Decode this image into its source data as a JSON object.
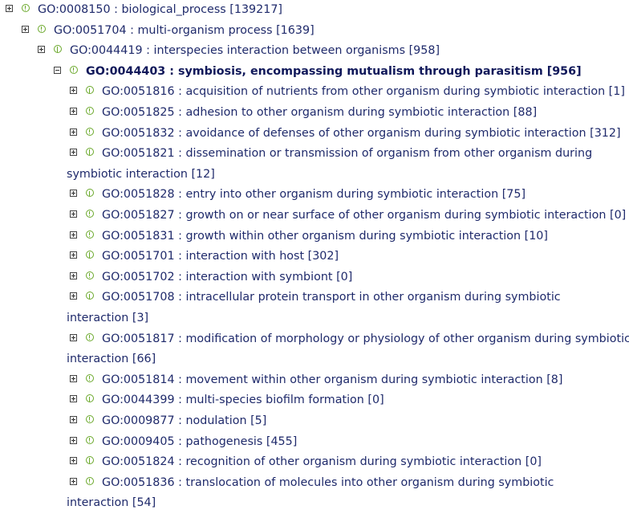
{
  "tree": [
    {
      "id": "GO:0008150",
      "name": "biological_process",
      "count": "[139217]",
      "expanded": false,
      "level": 0
    },
    {
      "id": "GO:0051704",
      "name": "multi-organism process",
      "count": "[1639]",
      "expanded": false,
      "level": 1
    },
    {
      "id": "GO:0044419",
      "name": "interspecies interaction between organisms",
      "count": "[958]",
      "expanded": false,
      "level": 2
    },
    {
      "id": "GO:0044403",
      "name": "symbiosis, encompassing mutualism through parasitism",
      "count": "[956]",
      "expanded": true,
      "level": 3,
      "bold": true
    },
    {
      "id": "GO:0051816",
      "name": "acquisition of nutrients from other organism during symbiotic interaction",
      "count": "[1]",
      "level": 4
    },
    {
      "id": "GO:0051825",
      "name": "adhesion to other organism during symbiotic interaction",
      "count": "[88]",
      "level": 4
    },
    {
      "id": "GO:0051832",
      "name": "avoidance of defenses of other organism during symbiotic interaction",
      "count": "[312]",
      "level": 4
    },
    {
      "id": "GO:0051821",
      "name": "dissemination or transmission of organism from other organism during",
      "cont": "symbiotic interaction",
      "count": "[12]",
      "level": 4
    },
    {
      "id": "GO:0051828",
      "name": "entry into other organism during symbiotic interaction",
      "count": "[75]",
      "level": 4
    },
    {
      "id": "GO:0051827",
      "name": "growth on or near surface of other organism during symbiotic interaction",
      "count": "[0]",
      "level": 4
    },
    {
      "id": "GO:0051831",
      "name": "growth within other organism during symbiotic interaction",
      "count": "[10]",
      "level": 4
    },
    {
      "id": "GO:0051701",
      "name": "interaction with host",
      "count": "[302]",
      "level": 4
    },
    {
      "id": "GO:0051702",
      "name": "interaction with symbiont",
      "count": "[0]",
      "level": 4
    },
    {
      "id": "GO:0051708",
      "name": "intracellular protein transport in other organism during symbiotic",
      "cont": "interaction",
      "count": "[3]",
      "level": 4
    },
    {
      "id": "GO:0051817",
      "name": "modification of morphology or physiology of other organism during symbiotic",
      "cont": "interaction",
      "count": "[66]",
      "level": 4
    },
    {
      "id": "GO:0051814",
      "name": "movement within other organism during symbiotic interaction",
      "count": "[8]",
      "level": 4
    },
    {
      "id": "GO:0044399",
      "name": "multi-species biofilm formation",
      "count": "[0]",
      "level": 4
    },
    {
      "id": "GO:0009877",
      "name": "nodulation",
      "count": "[5]",
      "level": 4
    },
    {
      "id": "GO:0009405",
      "name": "pathogenesis",
      "count": "[455]",
      "level": 4
    },
    {
      "id": "GO:0051824",
      "name": "recognition of other organism during symbiotic interaction",
      "count": "[0]",
      "level": 4
    },
    {
      "id": "GO:0051836",
      "name": "translocation of molecules into other organism during symbiotic",
      "cont": "interaction",
      "count": "[54]",
      "level": 4
    }
  ],
  "colors": {
    "link": "#1f2a6b",
    "info_icon": "#6aa82a"
  }
}
